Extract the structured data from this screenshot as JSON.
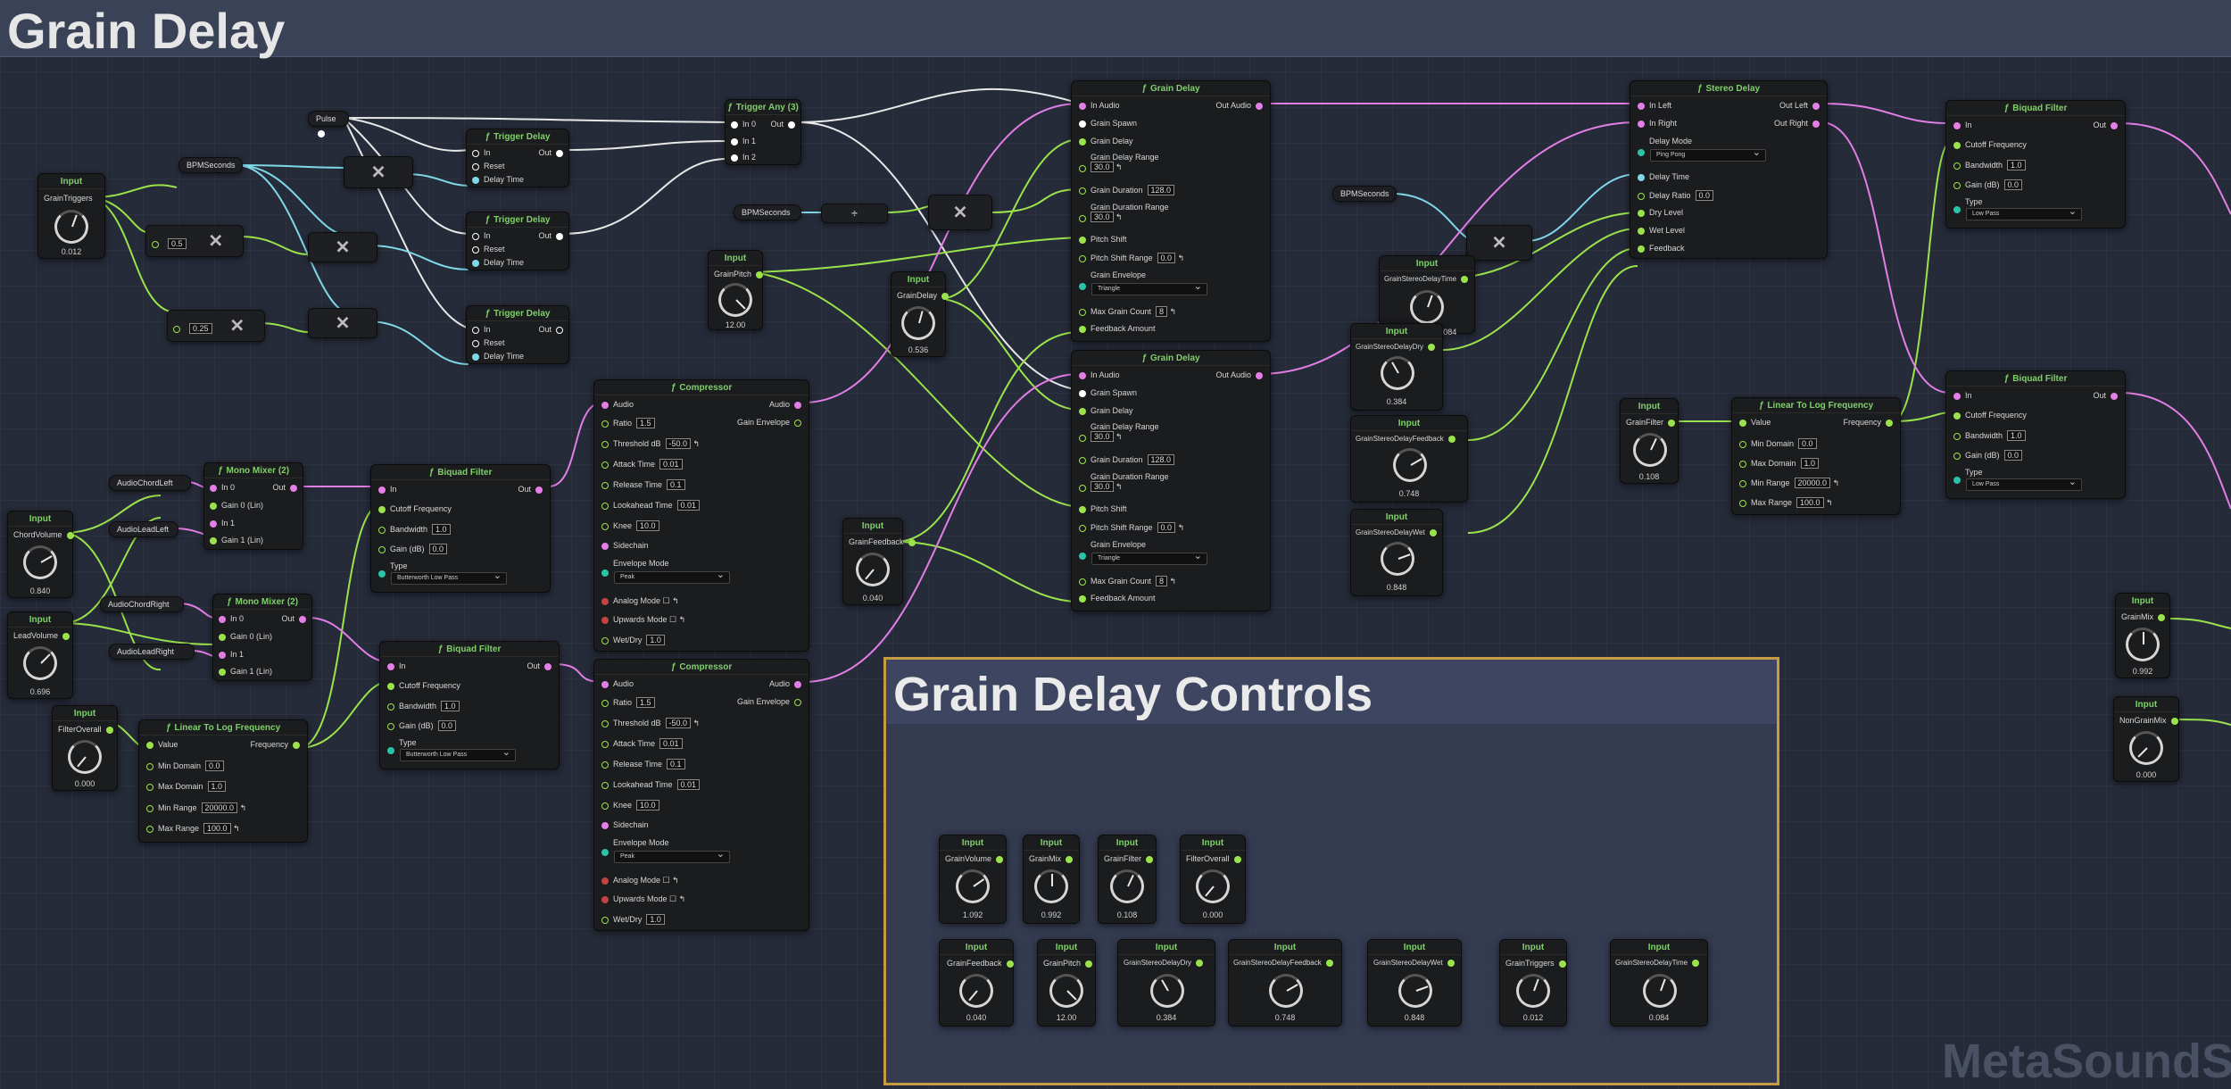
{
  "title": "Grain Delay",
  "watermark": "MetaSoundSo",
  "comment_title": "Grain Delay Controls",
  "reroutes": {
    "pulse": "Pulse",
    "bpm1": "BPMSeconds",
    "bpm2": "BPMSeconds",
    "bpm3": "BPMSeconds",
    "chord_left": "AudioChordLeft",
    "lead_left": "AudioLeadLeft",
    "chord_right": "AudioChordRight",
    "lead_right": "AudioLeadRight"
  },
  "consts": {
    "half": "0.5",
    "quarter": "0.25"
  },
  "input_header": "Input",
  "inputs": {
    "grain_triggers": {
      "name": "GrainTriggers",
      "value": "0.012"
    },
    "chord_volume": {
      "name": "ChordVolume",
      "value": "0.840"
    },
    "lead_volume": {
      "name": "LeadVolume",
      "value": "0.696"
    },
    "filter_overall": {
      "name": "FilterOverall",
      "value": "0.000"
    },
    "grain_pitch": {
      "name": "GrainPitch",
      "value": "12.00"
    },
    "grain_delay": {
      "name": "GrainDelay",
      "value": "0.536"
    },
    "grain_feedback": {
      "name": "GrainFeedback",
      "value": "0.040"
    },
    "stereo_time": {
      "name": "GrainStereoDelayTime",
      "value": "0.084"
    },
    "stereo_dry": {
      "name": "GrainStereoDelayDry",
      "value": "0.384"
    },
    "stereo_feedback": {
      "name": "GrainStereoDelayFeedback",
      "value": "0.748"
    },
    "stereo_wet": {
      "name": "GrainStereoDelayWet",
      "value": "0.848"
    },
    "grain_filter": {
      "name": "GrainFilter",
      "value": "0.108"
    },
    "grain_mix": {
      "name": "GrainMix",
      "value": "0.992"
    },
    "non_grain_mix": {
      "name": "NonGrainMix",
      "value": "0.000"
    }
  },
  "controls": [
    {
      "name": "GrainVolume",
      "value": "1.092"
    },
    {
      "name": "GrainMix",
      "value": "0.992"
    },
    {
      "name": "GrainFilter",
      "value": "0.108"
    },
    {
      "name": "FilterOverall",
      "value": "0.000"
    },
    {
      "name": "GrainFeedback",
      "value": "0.040"
    },
    {
      "name": "GrainPitch",
      "value": "12.00"
    },
    {
      "name": "GrainStereoDelayDry",
      "value": "0.384"
    },
    {
      "name": "GrainStereoDelayFeedback",
      "value": "0.748"
    },
    {
      "name": "GrainStereoDelayWet",
      "value": "0.848"
    },
    {
      "name": "GrainTriggers",
      "value": "0.012"
    },
    {
      "name": "GrainStereoDelayTime",
      "value": "0.084"
    }
  ],
  "trigger_delay": {
    "title": "Trigger Delay",
    "in": "In",
    "out": "Out",
    "reset": "Reset",
    "delay_time": "Delay Time"
  },
  "trigger_any": {
    "title": "Trigger Any (3)",
    "in0": "In 0",
    "in1": "In 1",
    "in2": "In 2",
    "out": "Out"
  },
  "mono_mixer": {
    "title": "Mono Mixer (2)",
    "in0": "In 0",
    "gain0": "Gain 0 (Lin)",
    "in1": "In 1",
    "gain1": "Gain 1 (Lin)",
    "out": "Out"
  },
  "biquad": {
    "title": "Biquad Filter",
    "in": "In",
    "out": "Out",
    "cutoff": "Cutoff Frequency",
    "bandwidth": "Bandwidth",
    "bandwidth_val": "1.0",
    "gain": "Gain (dB)",
    "gain_val": "0.0",
    "type": "Type",
    "type_bw": "Butterworth Low Pass",
    "type_lp": "Low Pass"
  },
  "lin2log": {
    "title": "Linear To Log Frequency",
    "value": "Value",
    "frequency": "Frequency",
    "min_domain": "Min Domain",
    "min_domain_val": "0.0",
    "max_domain": "Max Domain",
    "max_domain_val": "1.0",
    "min_range": "Min Range",
    "min_range_val": "20000.0",
    "max_range": "Max Range",
    "max_range_val": "100.0"
  },
  "compressor": {
    "title": "Compressor",
    "audio": "Audio",
    "audio_out": "Audio",
    "gain_env": "Gain Envelope",
    "ratio": "Ratio",
    "ratio_val": "1.5",
    "threshold": "Threshold dB",
    "threshold_val": "-50.0",
    "attack": "Attack Time",
    "attack_val": "0.01",
    "release": "Release Time",
    "release_val": "0.1",
    "lookahead": "Lookahead Time",
    "lookahead_val": "0.01",
    "knee": "Knee",
    "knee_val": "10.0",
    "sidechain": "Sidechain",
    "env_mode": "Envelope Mode",
    "env_mode_val": "Peak",
    "analog": "Analog Mode",
    "upwards": "Upwards Mode",
    "wetdry": "Wet/Dry",
    "wetdry_val": "1.0"
  },
  "grain_delay": {
    "title": "Grain Delay",
    "in_audio": "In Audio",
    "out_audio": "Out Audio",
    "grain_spawn": "Grain Spawn",
    "grain_delay": "Grain Delay",
    "grain_delay_range": "Grain Delay Range",
    "grain_delay_range_val": "30.0",
    "grain_duration": "Grain Duration",
    "grain_duration_val": "128.0",
    "grain_duration_range": "Grain Duration Range",
    "grain_duration_range_val": "30.0",
    "pitch_shift": "Pitch Shift",
    "pitch_shift_range": "Pitch Shift Range",
    "pitch_shift_range_val": "0.0",
    "grain_envelope": "Grain Envelope",
    "grain_envelope_val": "Triangle",
    "max_grain_count": "Max Grain Count",
    "max_grain_count_val": "8",
    "feedback_amount": "Feedback Amount"
  },
  "stereo_delay": {
    "title": "Stereo Delay",
    "in_left": "In Left",
    "in_right": "In Right",
    "out_left": "Out Left",
    "out_right": "Out Right",
    "delay_mode": "Delay Mode",
    "delay_mode_val": "Ping Pong",
    "delay_time": "Delay Time",
    "delay_ratio": "Delay Ratio",
    "delay_ratio_val": "0.0",
    "dry_level": "Dry Level",
    "wet_level": "Wet Level",
    "feedback": "Feedback"
  }
}
